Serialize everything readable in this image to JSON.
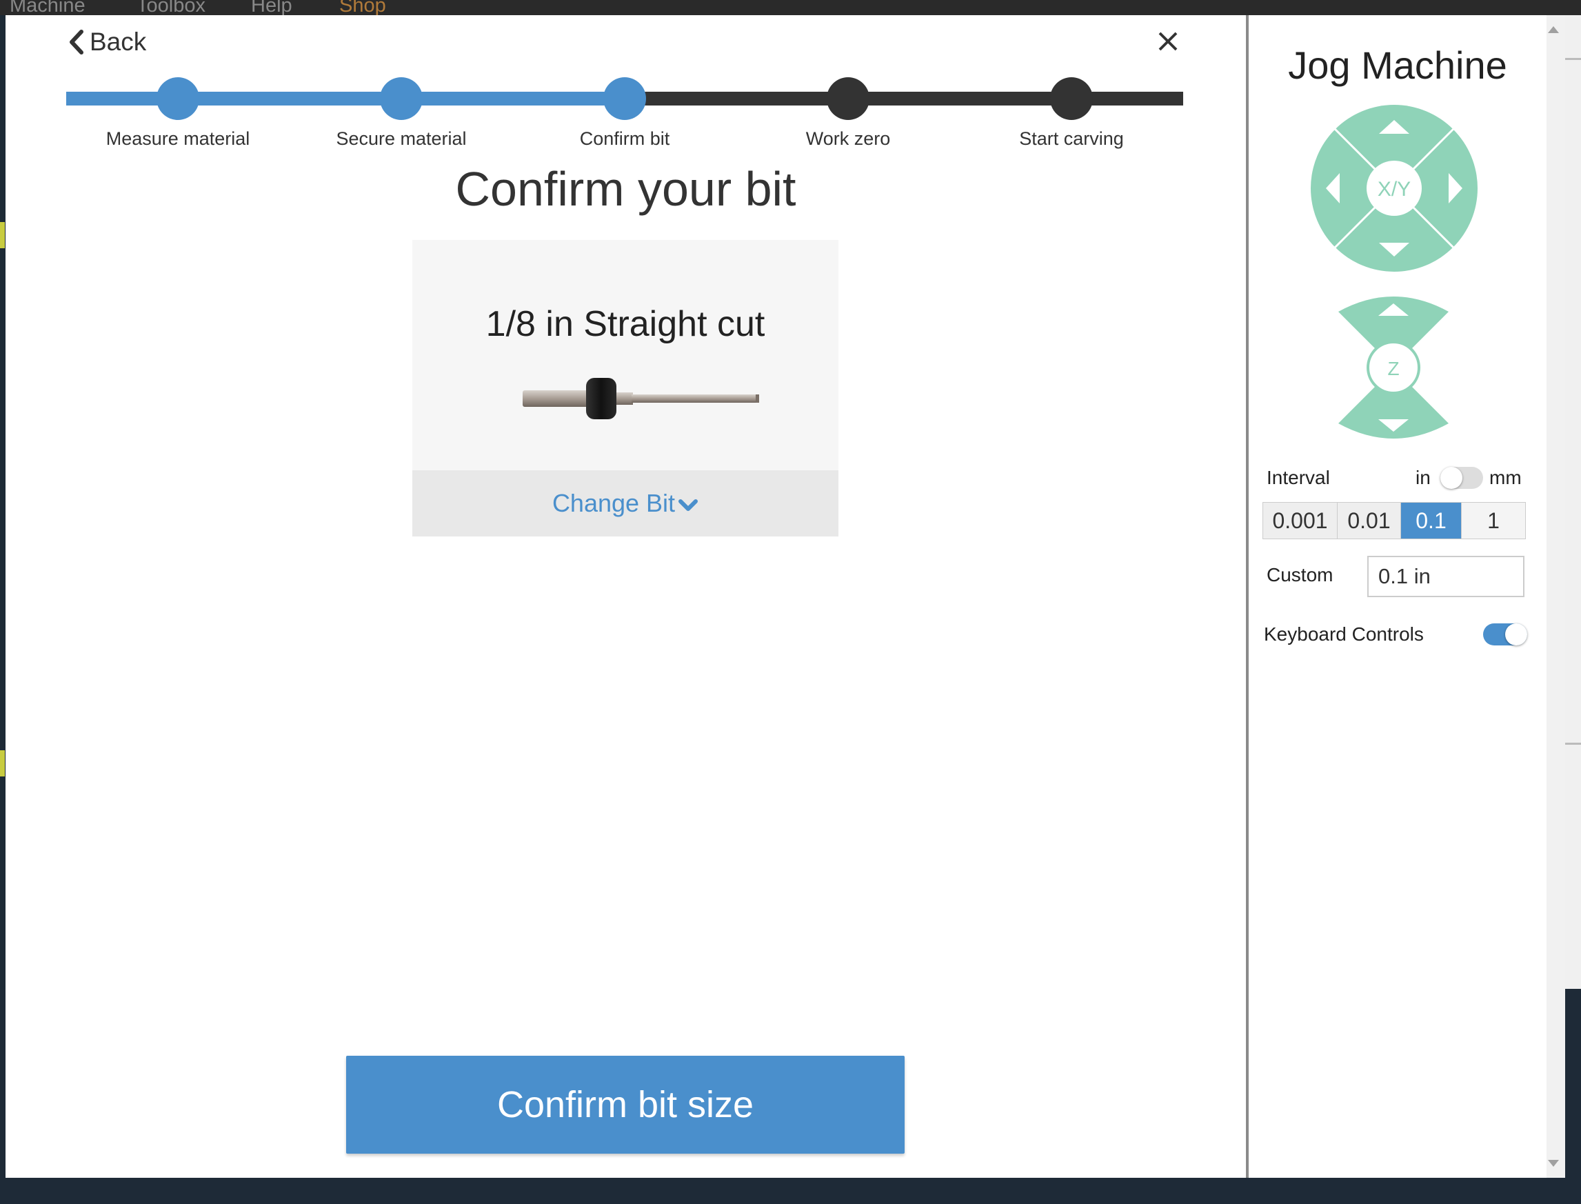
{
  "background": {
    "menu": [
      "Machine",
      "Toolbox",
      "Help",
      "Shop"
    ]
  },
  "nav": {
    "back_label": "Back",
    "back_icon": "chevron-left-icon",
    "close_icon": "close-icon"
  },
  "stepper": {
    "current_step": 3,
    "steps": [
      {
        "label": "Measure material"
      },
      {
        "label": "Secure material"
      },
      {
        "label": "Confirm bit"
      },
      {
        "label": "Work zero"
      },
      {
        "label": "Start carving"
      }
    ]
  },
  "main": {
    "title": "Confirm your bit",
    "bit": {
      "name": "1/8 in Straight cut",
      "change_label": "Change Bit",
      "change_icon": "chevron-down-icon"
    },
    "confirm_label": "Confirm bit size"
  },
  "jog": {
    "title": "Jog Machine",
    "xy_label": "X/Y",
    "z_label": "Z",
    "interval_label": "Interval",
    "unit_in": "in",
    "unit_mm": "mm",
    "intervals": [
      "0.001",
      "0.01",
      "0.1",
      "1"
    ],
    "selected_interval": "0.1",
    "custom_label": "Custom",
    "custom_value": "0.1 in",
    "keyboard_label": "Keyboard Controls",
    "keyboard_enabled": true
  },
  "colors": {
    "accent": "#4a8fcc",
    "jog_pad": "#8fd3b8",
    "step_inactive": "#333333"
  }
}
